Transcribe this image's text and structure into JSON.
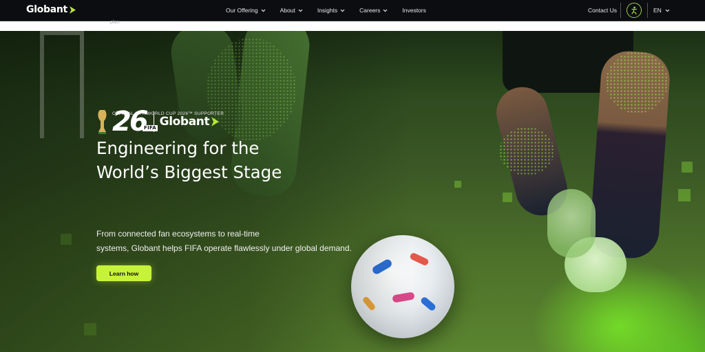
{
  "header": {
    "logo_text": "Globant",
    "menu": [
      {
        "label": "Our Offering",
        "has_dropdown": true
      },
      {
        "label": "About",
        "has_dropdown": true
      },
      {
        "label": "Insights",
        "has_dropdown": true
      },
      {
        "label": "Careers",
        "has_dropdown": true
      },
      {
        "label": "Investors",
        "has_dropdown": false
      }
    ],
    "contact_label": "Contact Us",
    "accessibility_icon": "accessibility-icon",
    "language": "EN"
  },
  "subbar": {
    "text": "plan."
  },
  "hero": {
    "badge": {
      "number": "26",
      "fifa_tag": "FIFA",
      "partner_logo": "Globant",
      "tagline": "OFFICIAL FIFA WORLD CUP 2026™ SUPPORTER"
    },
    "headline_line1": "Engineering for the",
    "headline_line2": "World’s Biggest Stage",
    "description_line1": "From connected fan ecosystems to real-time",
    "description_line2": "systems, Globant helps FIFA operate flawlessly under global demand.",
    "cta_label": "Learn how"
  },
  "colors": {
    "nav_bg": "#0c0d10",
    "accent": "#c7f23a",
    "brand_green": "#9ed34a"
  }
}
